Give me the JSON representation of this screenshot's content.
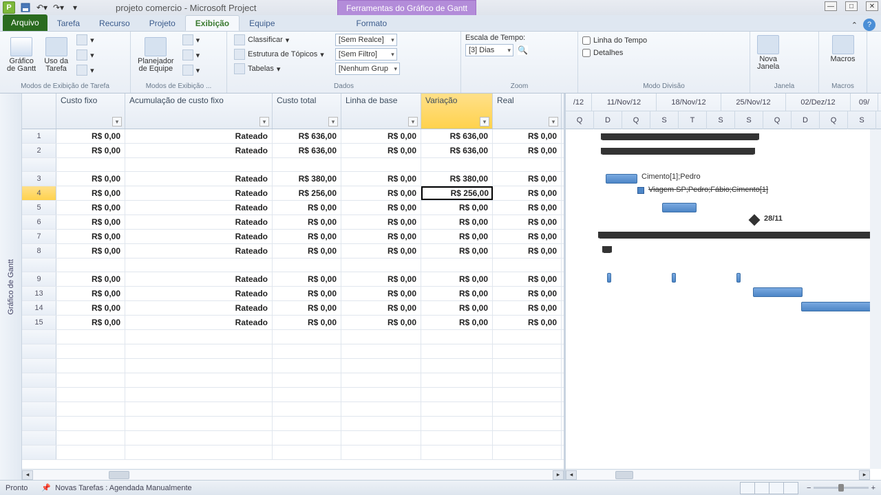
{
  "titlebar": {
    "app_letter": "P",
    "title": "projeto comercio  -  Microsoft Project",
    "context_tab": "Ferramentas do Gráfico de Gantt"
  },
  "tabs": {
    "file": "Arquivo",
    "items": [
      "Tarefa",
      "Recurso",
      "Projeto",
      "Exibição",
      "Equipe"
    ],
    "active": "Exibição",
    "format": "Formato"
  },
  "ribbon": {
    "g1_label": "Modos de Exibição de Tarefa",
    "gantt": "Gráfico\nde Gantt",
    "usage": "Uso da\nTarefa",
    "g2_label": "Modos de Exibição ...",
    "planner": "Planejador\nde Equipe",
    "g3_label": "Dados",
    "sort": "Classificar",
    "outline": "Estrutura de Tópicos",
    "tables": "Tabelas",
    "highlight": "[Sem Realce]",
    "filter": "[Sem Filtro]",
    "group": "[Nenhum Grup",
    "timescale_label": "Escala de Tempo:",
    "timescale": "[3] Dias",
    "g4_label": "Zoom",
    "timeline": "Linha do Tempo",
    "details": "Detalhes",
    "g5_label": "Modo Divisão",
    "newwin": "Nova\nJanela",
    "g6_label": "Janela",
    "macros": "Macros",
    "g7_label": "Macros"
  },
  "sidebar": "Gráfico de Gantt",
  "columns": {
    "cf": "Custo fixo",
    "ac": "Acumulação de custo fixo",
    "ct": "Custo total",
    "lb": "Linha de base",
    "var": "Variação",
    "real": "Real"
  },
  "rows": [
    {
      "n": "1",
      "cf": "R$ 0,00",
      "ac": "Rateado",
      "ct": "R$ 636,00",
      "lb": "R$ 0,00",
      "var": "R$ 636,00",
      "real": "R$ 0,00"
    },
    {
      "n": "2",
      "cf": "R$ 0,00",
      "ac": "Rateado",
      "ct": "R$ 636,00",
      "lb": "R$ 0,00",
      "var": "R$ 636,00",
      "real": "R$ 0,00"
    },
    {
      "gap": true
    },
    {
      "n": "3",
      "cf": "R$ 0,00",
      "ac": "Rateado",
      "ct": "R$ 380,00",
      "lb": "R$ 0,00",
      "var": "R$ 380,00",
      "real": "R$ 0,00"
    },
    {
      "n": "4",
      "cf": "R$ 0,00",
      "ac": "Rateado",
      "ct": "R$ 256,00",
      "lb": "R$ 0,00",
      "var": "R$ 256,00",
      "real": "R$ 0,00",
      "sel": true,
      "selcell": "var"
    },
    {
      "n": "5",
      "cf": "R$ 0,00",
      "ac": "Rateado",
      "ct": "R$ 0,00",
      "lb": "R$ 0,00",
      "var": "R$ 0,00",
      "real": "R$ 0,00"
    },
    {
      "n": "6",
      "cf": "R$ 0,00",
      "ac": "Rateado",
      "ct": "R$ 0,00",
      "lb": "R$ 0,00",
      "var": "R$ 0,00",
      "real": "R$ 0,00"
    },
    {
      "n": "7",
      "cf": "R$ 0,00",
      "ac": "Rateado",
      "ct": "R$ 0,00",
      "lb": "R$ 0,00",
      "var": "R$ 0,00",
      "real": "R$ 0,00"
    },
    {
      "n": "8",
      "cf": "R$ 0,00",
      "ac": "Rateado",
      "ct": "R$ 0,00",
      "lb": "R$ 0,00",
      "var": "R$ 0,00",
      "real": "R$ 0,00"
    },
    {
      "gap": true
    },
    {
      "n": "9",
      "cf": "R$ 0,00",
      "ac": "Rateado",
      "ct": "R$ 0,00",
      "lb": "R$ 0,00",
      "var": "R$ 0,00",
      "real": "R$ 0,00"
    },
    {
      "n": "13",
      "cf": "R$ 0,00",
      "ac": "Rateado",
      "ct": "R$ 0,00",
      "lb": "R$ 0,00",
      "var": "R$ 0,00",
      "real": "R$ 0,00"
    },
    {
      "n": "14",
      "cf": "R$ 0,00",
      "ac": "Rateado",
      "ct": "R$ 0,00",
      "lb": "R$ 0,00",
      "var": "R$ 0,00",
      "real": "R$ 0,00"
    },
    {
      "n": "15",
      "cf": "R$ 0,00",
      "ac": "Rateado",
      "ct": "R$ 0,00",
      "lb": "R$ 0,00",
      "var": "R$ 0,00",
      "real": "R$ 0,00"
    }
  ],
  "timeline": {
    "weeks": [
      "/12",
      "11/Nov/12",
      "18/Nov/12",
      "25/Nov/12",
      "02/Dez/12",
      "09/"
    ],
    "days": [
      "Q",
      "D",
      "Q",
      "S",
      "T",
      "S",
      "S",
      "Q",
      "D",
      "Q",
      "S"
    ]
  },
  "gantt_labels": {
    "r3": "Cimento[1];Pedro",
    "r4": "Viagem SP;Pedro;Fábio;Cimento[1]",
    "r6": "28/11"
  },
  "status": {
    "ready": "Pronto",
    "newtasks": "Novas Tarefas : Agendada Manualmente"
  }
}
